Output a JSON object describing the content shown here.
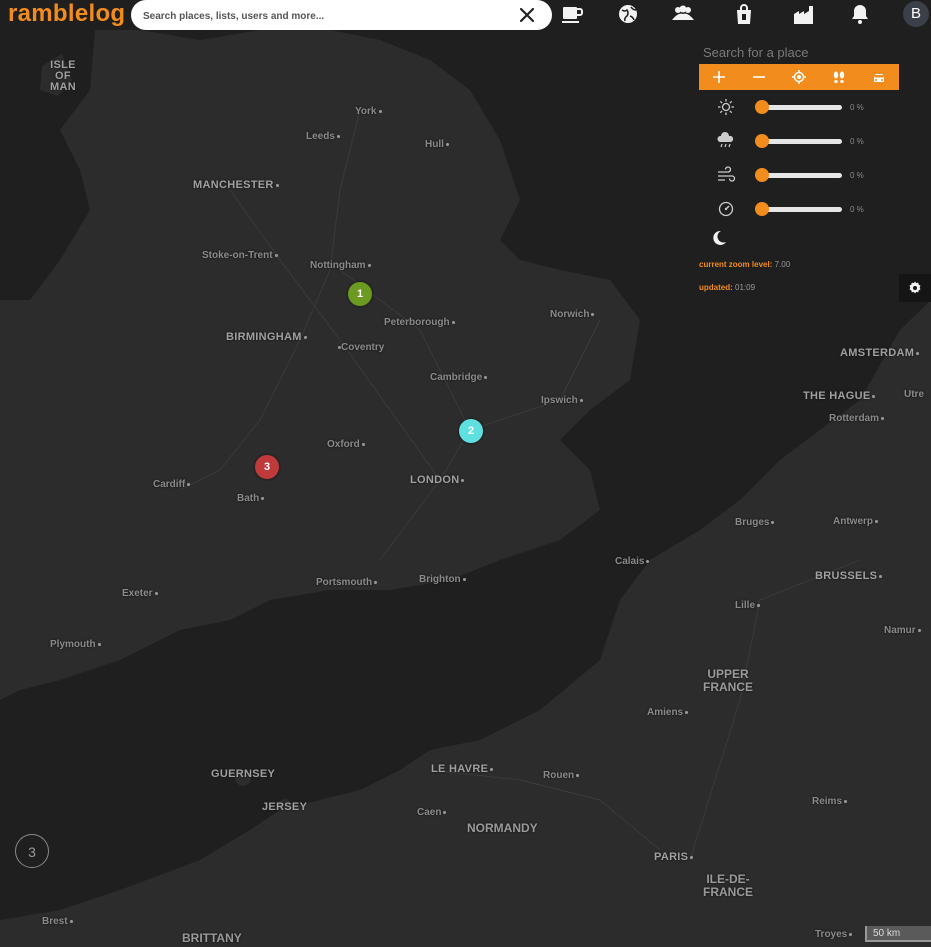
{
  "app": {
    "logo": "ramblelog"
  },
  "search": {
    "placeholder": "Search places, lists, users and more..."
  },
  "nav": {
    "icons": [
      "coffee-cup-icon",
      "globe-icon",
      "group-icon",
      "shopping-bag-icon",
      "factory-icon",
      "bell-icon"
    ]
  },
  "user": {
    "avatar_letter": "B"
  },
  "panel": {
    "place_search_placeholder": "Search for a place",
    "controls": [
      "zoom-in-icon",
      "zoom-out-icon",
      "locate-icon",
      "footsteps-icon",
      "car-icon"
    ],
    "sliders": [
      {
        "icon": "sun-icon",
        "value": 0,
        "label": "0 %"
      },
      {
        "icon": "rain-cloud-icon",
        "value": 0,
        "label": "0 %"
      },
      {
        "icon": "wind-icon",
        "value": 0,
        "label": "0 %"
      },
      {
        "icon": "gauge-icon",
        "value": 0,
        "label": "0 %"
      }
    ],
    "zoom_label": "current zoom level:",
    "zoom_value": "7.00",
    "updated_label": "updated:",
    "updated_value": "01:09"
  },
  "map": {
    "cities": {
      "isle_of_man": "ISLE\nOF\nMAN",
      "york": "York",
      "leeds": "Leeds",
      "hull": "Hull",
      "manchester": "MANCHESTER",
      "stoke": "Stoke-on-Trent",
      "nottingham": "Nottingham",
      "birmingham": "BIRMINGHAM",
      "coventry": "Coventry",
      "peterborough": "Peterborough",
      "norwich": "Norwich",
      "cambridge": "Cambridge",
      "ipswich": "Ipswich",
      "oxford": "Oxford",
      "london": "LONDON",
      "cardiff": "Cardiff",
      "bath": "Bath",
      "exeter": "Exeter",
      "plymouth": "Plymouth",
      "portsmouth": "Portsmouth",
      "brighton": "Brighton",
      "calais": "Calais",
      "amsterdam": "AMSTERDAM",
      "the_hague": "THE HAGUE",
      "rotterdam": "Rotterdam",
      "utrecht": "Utre",
      "bruges": "Bruges",
      "antwerp": "Antwerp",
      "brussels": "BRUSSELS",
      "lille": "Lille",
      "namur": "Namur",
      "upper_france": "UPPER\nFRANCE",
      "amiens": "Amiens",
      "guernsey": "GUERNSEY",
      "jersey": "JERSEY",
      "le_havre": "LE HAVRE",
      "rouen": "Rouen",
      "caen": "Caen",
      "normandy": "NORMANDY",
      "reims": "Reims",
      "paris": "PARIS",
      "ile_de_france": "ILE-DE-\nFRANCE",
      "brest": "Brest",
      "brittany": "BRITTANY",
      "troyes": "Troyes"
    },
    "markers": [
      {
        "label": "1",
        "color": "#6a9a1f"
      },
      {
        "label": "2",
        "color": "#5fe0e0"
      },
      {
        "label": "3",
        "color": "#c0393b"
      }
    ],
    "cluster_count": "3",
    "scale_label": "50 km"
  },
  "colors": {
    "accent": "#f28c1c",
    "land": "#2c2c2c",
    "sea": "#1f1f1f"
  }
}
